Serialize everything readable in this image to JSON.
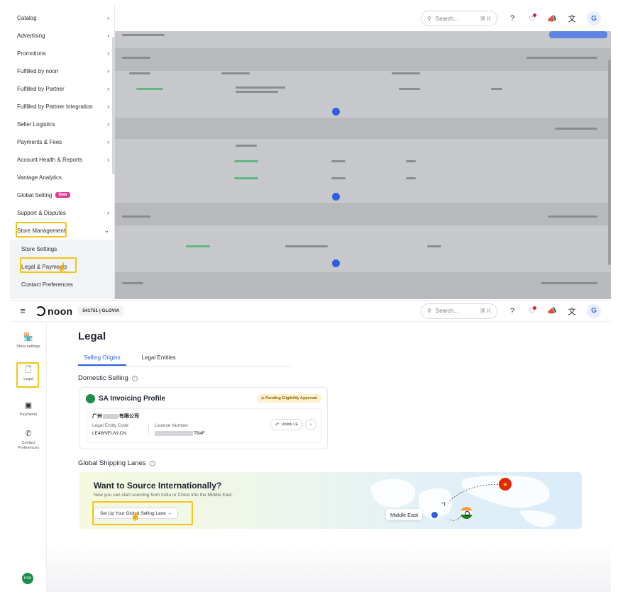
{
  "header": {
    "search_placeholder": "Search...",
    "shortcut": "⌘ K",
    "avatar_initial": "G"
  },
  "sidebar_menu": {
    "items": [
      {
        "label": "Catalog",
        "has_arrow": true
      },
      {
        "label": "Advertising",
        "has_arrow": true
      },
      {
        "label": "Promotions",
        "has_arrow": true
      },
      {
        "label": "Fulfilled by noon",
        "has_arrow": true
      },
      {
        "label": "Fulfilled by Partner",
        "has_arrow": true
      },
      {
        "label": "Fulfilled by Partner Integration",
        "has_arrow": true
      },
      {
        "label": "Seller Logistics",
        "has_arrow": true
      },
      {
        "label": "Payments & Fees",
        "has_arrow": true
      },
      {
        "label": "Account Health & Reports",
        "has_arrow": true
      },
      {
        "label": "Vantage Analytics",
        "has_arrow": false
      },
      {
        "label": "Global Selling",
        "has_arrow": false,
        "badge": "New"
      },
      {
        "label": "Support & Disputes",
        "has_arrow": true
      },
      {
        "label": "Store Management",
        "has_arrow": true,
        "expanded": true
      }
    ],
    "sub_items": [
      "Store Settings",
      "Legal & Payments",
      "Contact Preferences"
    ],
    "badge_color": "#e23a8d"
  },
  "app": {
    "logo_text": "noon",
    "store_label": "541751 | GLOVIA"
  },
  "rail": {
    "items": [
      {
        "label": "Store settings",
        "icon": "store-icon"
      },
      {
        "label": "Legal",
        "icon": "document-icon"
      },
      {
        "label": "Payments",
        "icon": "cash-icon"
      },
      {
        "label": "Contact Preferences",
        "icon": "phone-icon"
      }
    ]
  },
  "page": {
    "title": "Legal",
    "tabs": [
      "Selling Origins",
      "Legal Entities"
    ],
    "active_tab": "Selling Origins",
    "domestic_title": "Domestic Selling",
    "profile": {
      "title": "SA Invoicing Profile",
      "status": "Pending Eligibility Approval",
      "entity_prefix": "广州",
      "entity_suffix": "有限公司",
      "code_label": "Legal Entity Code",
      "code_value": "LE4WVFUVLCN",
      "license_label": "License Number",
      "license_suffix": "TB4F",
      "unlink_label": "Unlink LE"
    },
    "lanes_title": "Global Shipping Lanes",
    "banner": {
      "title": "Want to Source Internationally?",
      "subtitle": "Now you can start sourcing from India or China into the Middle East.",
      "button": "Set Up Your Global Selling Lane →",
      "destination": "Middle East"
    }
  },
  "colors": {
    "accent": "#2d5fe0",
    "highlight": "#f5c518",
    "pending_bg": "#fdf1cf"
  }
}
